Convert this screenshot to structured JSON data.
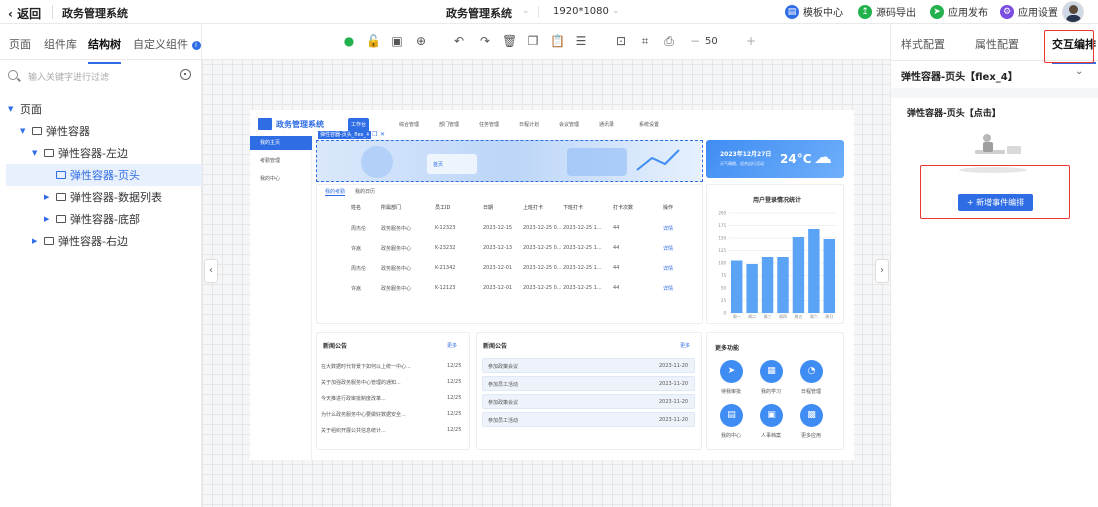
{
  "topbar": {
    "back_label": "返回",
    "app_name": "政务管理系统",
    "center_title": "政务管理系统",
    "resolution": "1920*1080",
    "template_center": "模板中心",
    "code_export": "源码导出",
    "app_publish": "应用发布",
    "app_settings": "应用设置"
  },
  "left_panel": {
    "tabs": [
      "页面",
      "组件库",
      "结构树",
      "自定义组件"
    ],
    "active_tab": "结构树",
    "search_placeholder": "输入关键字进行过滤",
    "tree": [
      {
        "label": "页面",
        "level": 0,
        "expanded": true
      },
      {
        "label": "弹性容器",
        "level": 1,
        "expanded": true
      },
      {
        "label": "弹性容器-左边",
        "level": 2,
        "expanded": true
      },
      {
        "label": "弹性容器-页头",
        "level": 3,
        "selected": true
      },
      {
        "label": "弹性容器-数据列表",
        "level": 3,
        "expanded": false
      },
      {
        "label": "弹性容器-底部",
        "level": 3,
        "expanded": false
      },
      {
        "label": "弹性容器-右边",
        "level": 2,
        "expanded": false
      }
    ]
  },
  "toolbar": {
    "zoom": "50",
    "icons": [
      "check-icon",
      "lock-icon",
      "save-icon",
      "target-icon",
      "undo-icon",
      "redo-icon",
      "delete-icon",
      "copy-icon",
      "paste-icon",
      "align-icon",
      "preview-icon",
      "scan-icon",
      "export-icon"
    ]
  },
  "canvas_app": {
    "app_title": "政务管理系统",
    "nav_items": [
      "工作台",
      "综合管理",
      "部门管理",
      "任务管理",
      "日程计划",
      "会议管理",
      "通讯录",
      "系统设置"
    ],
    "side_items": [
      "我的主页",
      "考勤管理",
      "我的中心"
    ],
    "selected_component_tag": "弹性容器-页头_flex_4",
    "banner_text": "首页",
    "weather_date": "2023年12月27日",
    "weather_desc": "天气晴朗，适合出行活动",
    "weather_temp": "24°C",
    "table_tabs": [
      "我的考勤",
      "我的日历"
    ],
    "table_headers": [
      "姓名",
      "所属部门",
      "员工ID",
      "日期",
      "上班打卡",
      "下班打卡",
      "打卡次数",
      "操作"
    ],
    "table_rows": [
      [
        "周杰伦",
        "政务服务中心",
        "K-12323",
        "2023-12-15",
        "2023-12-25 0...",
        "2023-12-25 1...",
        "44",
        "详情"
      ],
      [
        "许嵩",
        "政务服务中心",
        "K-23232",
        "2023-12-13",
        "2023-12-25 0...",
        "2023-12-25 1...",
        "44",
        "详情"
      ],
      [
        "周杰伦",
        "政务服务中心",
        "K-21342",
        "2023-12-01",
        "2023-12-25 0...",
        "2023-12-25 1...",
        "44",
        "详情"
      ],
      [
        "许嵩",
        "政务服务中心",
        "K-12123",
        "2023-12-01",
        "2023-12-25 0...",
        "2023-12-25 1...",
        "44",
        "详情"
      ]
    ],
    "chart_title": "用户登录情况统计",
    "news_title": "新闻公告",
    "news_more": "更多",
    "news_items": [
      {
        "text": "在大数据时代背景下如何以上统一中心...",
        "date": "12/25"
      },
      {
        "text": "关于加强政务服务中心管理的通知...",
        "date": "12/25"
      },
      {
        "text": "今天推进行政审批制度改革...",
        "date": "12/25"
      },
      {
        "text": "为什么政务服务中心要做好数据安全...",
        "date": "12/25"
      },
      {
        "text": "关于组织开展公共信息统计...",
        "date": "12/25"
      }
    ],
    "notice_title": "新闻公告",
    "notice_more": "更多",
    "notices": [
      {
        "text": "参加政策会议",
        "date": "2023-11-20"
      },
      {
        "text": "参加员工活动",
        "date": "2023-11-20"
      },
      {
        "text": "参加政策会议",
        "date": "2023-11-20"
      },
      {
        "text": "参加员工活动",
        "date": "2023-11-20"
      }
    ],
    "quick_title": "更多功能",
    "quick_items": [
      "待我审批",
      "我的学习",
      "日程管理",
      "我的中心",
      "人事档案",
      "更多应用"
    ]
  },
  "chart_data": {
    "type": "bar",
    "title": "用户登录情况统计",
    "categories": [
      "周一",
      "周二",
      "周三",
      "周四",
      "周五",
      "周六",
      "周日"
    ],
    "values": [
      105,
      98,
      112,
      112,
      152,
      168,
      148
    ],
    "ylim": [
      0,
      200
    ],
    "color": "#5ba4f5"
  },
  "right_panel": {
    "tabs": [
      "样式配置",
      "属性配置",
      "交互编排"
    ],
    "active_tab": "交互编排",
    "component_title": "弹性容器-页头【flex_4】",
    "event_title": "弹性容器-页头【点击】",
    "add_event_button": "新增事件编排"
  },
  "colors": {
    "accent": "#2f6de5",
    "highlight": "#e33333",
    "bar": "#5ba4f5"
  }
}
